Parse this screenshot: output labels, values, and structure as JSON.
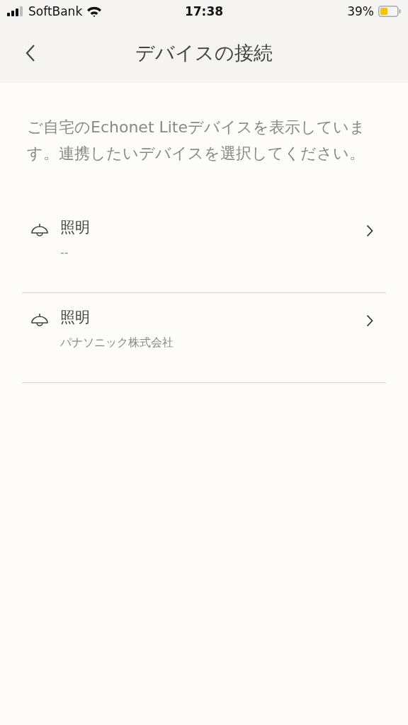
{
  "status_bar": {
    "carrier": "SoftBank",
    "time": "17:38",
    "battery": "39%"
  },
  "nav": {
    "title": "デバイスの接続"
  },
  "description": "ご自宅のEchonet Liteデバイスを表示しています。連携したいデバイスを選択してください。",
  "devices": [
    {
      "name": "照明",
      "maker": "--"
    },
    {
      "name": "照明",
      "maker": "パナソニック株式会社"
    }
  ]
}
